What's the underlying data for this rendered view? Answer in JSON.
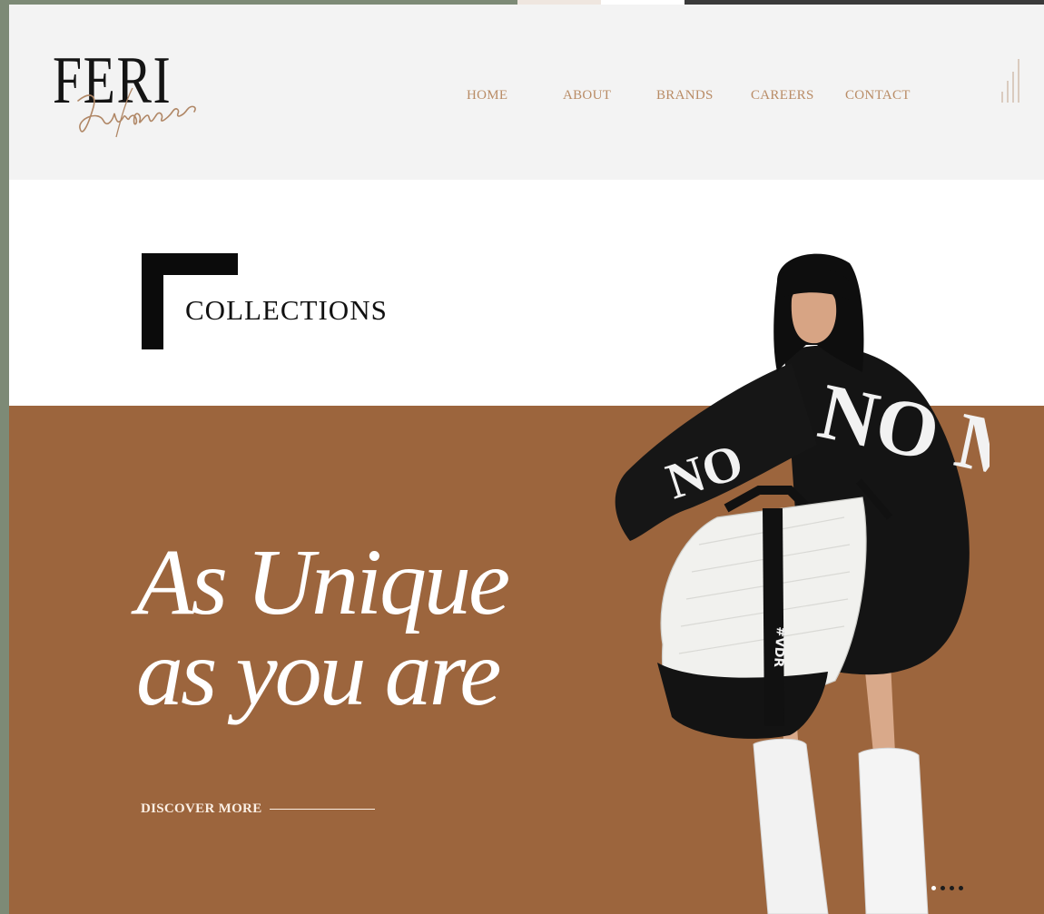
{
  "brand": {
    "wordmark": "FERI",
    "script": "Unique"
  },
  "nav": {
    "items": [
      {
        "label": "HOME"
      },
      {
        "label": "ABOUT"
      },
      {
        "label": "BRANDS"
      },
      {
        "label": "CAREERS"
      },
      {
        "label": "CONTACT"
      }
    ]
  },
  "section": {
    "title": "COLLECTIONS"
  },
  "hero": {
    "line1": "As Unique",
    "line2": "as you are",
    "cta_label": "DISCOVER MORE",
    "sweater_text": "NO ME",
    "sleeve_text": "NO",
    "bag_strap_text": "#VDR"
  },
  "slider": {
    "count": 4,
    "active_index": 0
  },
  "colors": {
    "accent": "#b98c66",
    "hero_bg": "#9c653d",
    "header_bg": "#f3f3f3"
  },
  "icons": {
    "menu": "menu-bars-icon"
  }
}
